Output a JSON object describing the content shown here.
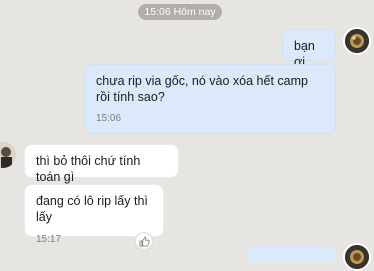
{
  "date_divider": "15:06 Hôm nay",
  "messages": [
    {
      "side": "out",
      "text": "bạn ơi"
    },
    {
      "side": "out",
      "text": "chưa rip via gốc, nó vào xóa hết camp rồi tính sao?",
      "time": "15:06"
    },
    {
      "side": "in",
      "text": "thì bỏ thôi chứ tính toán gì"
    },
    {
      "side": "in",
      "text": "đang có lô rip lấy thì lấy",
      "time": "15:17"
    }
  ],
  "icons": {
    "reaction": "thumbs-up-icon",
    "self_avatar": "avatar",
    "contact_avatar": "avatar"
  }
}
